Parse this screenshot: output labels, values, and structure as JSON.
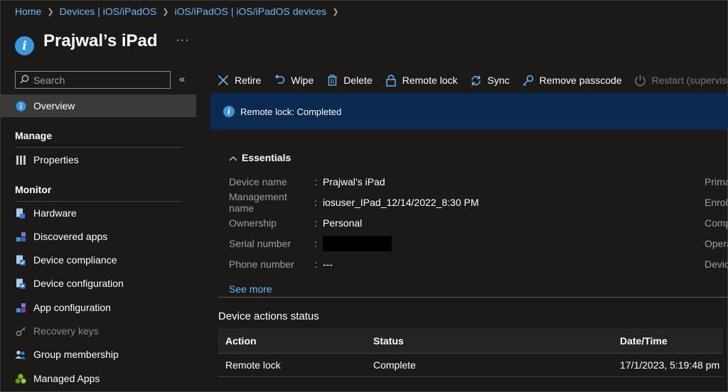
{
  "breadcrumb": [
    "Home",
    "Devices | iOS/iPadOS",
    "iOS/iPadOS | iOS/iPadOS devices"
  ],
  "page": {
    "title": "Prajwal’s iPad",
    "more": "···"
  },
  "sidebar": {
    "search_placeholder": "Search",
    "collapse": "«",
    "overview": "Overview",
    "manage_header": "Manage",
    "properties": "Properties",
    "monitor_header": "Monitor",
    "monitor_items": [
      {
        "label": "Hardware",
        "icon": "hardware-icon"
      },
      {
        "label": "Discovered apps",
        "icon": "apps-icon"
      },
      {
        "label": "Device compliance",
        "icon": "compliance-icon"
      },
      {
        "label": "Device configuration",
        "icon": "configuration-icon"
      },
      {
        "label": "App configuration",
        "icon": "app-config-icon"
      },
      {
        "label": "Recovery keys",
        "icon": "key-icon"
      },
      {
        "label": "Group membership",
        "icon": "group-icon"
      },
      {
        "label": "Managed Apps",
        "icon": "managed-apps-icon"
      }
    ]
  },
  "toolbar": {
    "retire": "Retire",
    "wipe": "Wipe",
    "delete": "Delete",
    "remote_lock": "Remote lock",
    "sync": "Sync",
    "remove_passcode": "Remove passcode",
    "restart": "Restart (supervised only)"
  },
  "banner": {
    "text": "Remote lock: Completed"
  },
  "essentials": {
    "header": "Essentials",
    "rows": [
      {
        "label": "Device name",
        "value": "Prajwal’s iPad"
      },
      {
        "label": "Management name",
        "value": "iosuser_IPad_12/14/2022_8:30 PM"
      },
      {
        "label": "Ownership",
        "value": "Personal"
      },
      {
        "label": "Serial number",
        "value": ""
      },
      {
        "label": "Phone number",
        "value": "---"
      }
    ],
    "right_labels": [
      "Prima",
      "Enrol",
      "Comp",
      "Opera",
      "Devic"
    ],
    "see_more": "See more"
  },
  "actions_status": {
    "title": "Device actions status",
    "columns": [
      "Action",
      "Status",
      "Date/Time"
    ],
    "rows": [
      {
        "action": "Remote lock",
        "status": "Complete",
        "datetime": "17/1/2023, 5:19:48 pm"
      }
    ]
  },
  "colors": {
    "accent": "#3a96dd",
    "link": "#6cb8f6",
    "banner_bg": "#0b2a52",
    "background": "#1b1a19"
  }
}
